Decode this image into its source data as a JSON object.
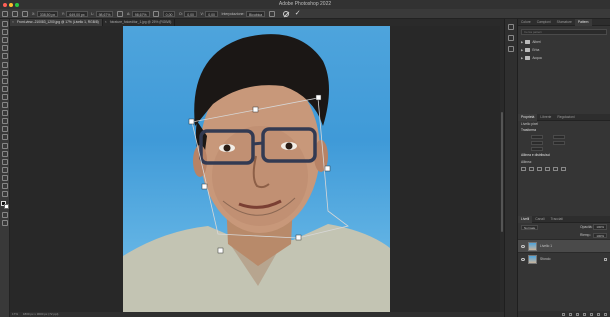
{
  "window": {
    "title": "Adobe Photoshop 2022",
    "traffic_colors": [
      "#ff5f57",
      "#febc2e",
      "#28c840"
    ]
  },
  "options_bar": {
    "x_value": "338,50 px",
    "y_value": "649,00 px",
    "w_value": "98,67%",
    "h_value": "98,67%",
    "angle_value": "0,00",
    "h_skew": "0,00",
    "v_skew": "0,00",
    "interpolation_label": "Interpolazione:",
    "interpolation_value": "Bicubica"
  },
  "tabs": [
    {
      "label": "Front-view--210083_1200.jpg @ 17% (Livello 1, RGB/8)",
      "active": true
    },
    {
      "label": "fotrature_fotoeditor_1.jpg @ 25% (RGB/8)",
      "active": false
    }
  ],
  "status": {
    "zoom": "17%",
    "doc_size": "1800 px x 3000 px (72 ppi)"
  },
  "panel_top": {
    "tabs": [
      "Colore",
      "Campioni",
      "Sfumature",
      "Pattern"
    ],
    "active": "Pattern",
    "search_placeholder": "Cerca pattern",
    "folders": [
      "Alberi",
      "Erba",
      "Acqua"
    ]
  },
  "properties": {
    "tabs": [
      "Proprietà",
      "Librerie",
      "Regolazioni"
    ],
    "active": "Proprietà",
    "layer_kind": "Livello pixel",
    "transform_title": "Trasforma",
    "align_title": "Allinea e distribuisci",
    "align_sub": "Allinea:"
  },
  "layers": {
    "tabs": [
      "Livelli",
      "Canali",
      "Tracciati"
    ],
    "active": "Livelli",
    "blend_mode": "Normale",
    "opacity_label": "Opacità:",
    "opacity_value": "100%",
    "fill_label": "Riemp.:",
    "fill_value": "100%",
    "items": [
      {
        "name": "Livello 1",
        "selected": true
      },
      {
        "name": "Sfondo",
        "selected": false
      }
    ]
  }
}
